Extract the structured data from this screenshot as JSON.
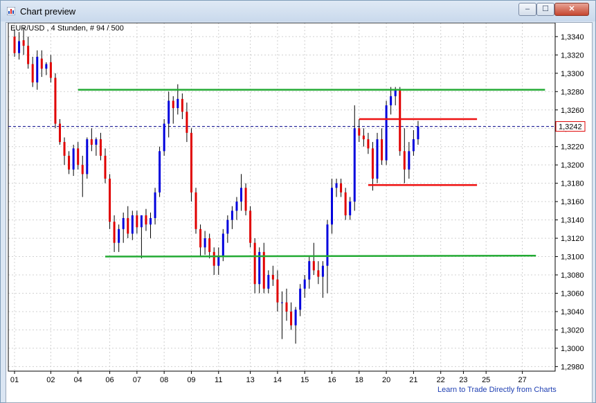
{
  "window": {
    "title": "Chart preview",
    "min_icon": "minimize-icon",
    "max_icon": "maximize-icon",
    "close_icon": "close-icon",
    "min_glyph": "–",
    "max_glyph": "☐",
    "close_glyph": "✕"
  },
  "chart_header": "EUR/USD , 4 Stunden, # 94 / 500",
  "footer_link": "Learn to Trade Directly from Charts",
  "current_price_label": "1,3242",
  "colors": {
    "up": "#0000dd",
    "down": "#e00000",
    "support": "#22aa33",
    "range": "#ee1111",
    "price_line": "#000088"
  },
  "chart_data": {
    "type": "candlestick",
    "title": "EUR/USD , 4 Stunden, # 94 / 500",
    "y_ticks": [
      "1,3340",
      "1,3320",
      "1,3300",
      "1,3280",
      "1,3260",
      "1,3240",
      "1,3220",
      "1,3200",
      "1,3180",
      "1,3160",
      "1,3140",
      "1,3120",
      "1,3100",
      "1,3080",
      "1,3060",
      "1,3040",
      "1,3020",
      "1,3000",
      "1,2980"
    ],
    "ylim": [
      1.2975,
      1.3355
    ],
    "x_ticks": [
      "01",
      "02",
      "04",
      "06",
      "07",
      "08",
      "09",
      "11",
      "13",
      "14",
      "15",
      "16",
      "18",
      "20",
      "21",
      "22",
      "23",
      "25",
      "27"
    ],
    "x_tick_index": [
      0,
      8,
      14,
      21,
      27,
      33,
      39,
      45,
      52,
      58,
      64,
      70,
      76,
      82,
      88,
      94,
      99,
      104,
      112
    ],
    "current_price": 1.3242,
    "lines": [
      {
        "name": "resistance",
        "color": "support",
        "i0": 14,
        "i1": 117,
        "y0": 1.3282,
        "y1": 1.3282
      },
      {
        "name": "support",
        "color": "support",
        "i0": 20,
        "i1": 115,
        "y0": 1.31,
        "y1": 1.3101
      },
      {
        "name": "range-top",
        "color": "range",
        "i0": 76,
        "i1": 102,
        "y0": 1.325,
        "y1": 1.325
      },
      {
        "name": "range-bottom",
        "color": "range",
        "i0": 78,
        "i1": 102,
        "y0": 1.3178,
        "y1": 1.3178
      }
    ],
    "ohlc": [
      [
        1.334,
        1.3348,
        1.3318,
        1.3322
      ],
      [
        1.3322,
        1.3345,
        1.3315,
        1.3335
      ],
      [
        1.3336,
        1.335,
        1.332,
        1.333
      ],
      [
        1.333,
        1.334,
        1.3305,
        1.331
      ],
      [
        1.331,
        1.3318,
        1.3285,
        1.329
      ],
      [
        1.329,
        1.3325,
        1.3282,
        1.3318
      ],
      [
        1.3316,
        1.3325,
        1.3296,
        1.3305
      ],
      [
        1.3305,
        1.3312,
        1.3298,
        1.331
      ],
      [
        1.3312,
        1.332,
        1.329,
        1.3295
      ],
      [
        1.3295,
        1.33,
        1.324,
        1.3245
      ],
      [
        1.3245,
        1.325,
        1.3222,
        1.3225
      ],
      [
        1.3225,
        1.323,
        1.32,
        1.321
      ],
      [
        1.321,
        1.3215,
        1.319,
        1.3195
      ],
      [
        1.3195,
        1.3222,
        1.3188,
        1.3218
      ],
      [
        1.3218,
        1.3225,
        1.3195,
        1.32
      ],
      [
        1.32,
        1.321,
        1.3165,
        1.319
      ],
      [
        1.319,
        1.323,
        1.3185,
        1.3228
      ],
      [
        1.3228,
        1.324,
        1.3215,
        1.3222
      ],
      [
        1.3222,
        1.323,
        1.321,
        1.3228
      ],
      [
        1.3228,
        1.3235,
        1.3205,
        1.321
      ],
      [
        1.321,
        1.3218,
        1.318,
        1.3185
      ],
      [
        1.3185,
        1.319,
        1.313,
        1.3138
      ],
      [
        1.3138,
        1.3145,
        1.3105,
        1.3115
      ],
      [
        1.3115,
        1.3135,
        1.3105,
        1.313
      ],
      [
        1.313,
        1.3148,
        1.3115,
        1.3142
      ],
      [
        1.3142,
        1.3155,
        1.312,
        1.3125
      ],
      [
        1.3125,
        1.315,
        1.3118,
        1.3145
      ],
      [
        1.3145,
        1.315,
        1.3125,
        1.3132
      ],
      [
        1.3132,
        1.314,
        1.3098,
        1.3145
      ],
      [
        1.3145,
        1.3152,
        1.3128,
        1.3135
      ],
      [
        1.3135,
        1.3148,
        1.312,
        1.3142
      ],
      [
        1.3142,
        1.3175,
        1.3135,
        1.317
      ],
      [
        1.317,
        1.322,
        1.3165,
        1.3215
      ],
      [
        1.3215,
        1.325,
        1.321,
        1.3245
      ],
      [
        1.3245,
        1.328,
        1.323,
        1.327
      ],
      [
        1.327,
        1.3275,
        1.3245,
        1.3262
      ],
      [
        1.3262,
        1.3288,
        1.3255,
        1.3272
      ],
      [
        1.3272,
        1.3278,
        1.325,
        1.3258
      ],
      [
        1.3258,
        1.3268,
        1.3225,
        1.3235
      ],
      [
        1.3235,
        1.324,
        1.316,
        1.317
      ],
      [
        1.317,
        1.3175,
        1.3125,
        1.313
      ],
      [
        1.313,
        1.3135,
        1.31,
        1.311
      ],
      [
        1.311,
        1.3128,
        1.3102,
        1.312
      ],
      [
        1.312,
        1.3125,
        1.3098,
        1.3105
      ],
      [
        1.3105,
        1.311,
        1.308,
        1.309
      ],
      [
        1.309,
        1.311,
        1.308,
        1.31
      ],
      [
        1.31,
        1.313,
        1.3095,
        1.3125
      ],
      [
        1.3125,
        1.3145,
        1.3115,
        1.314
      ],
      [
        1.314,
        1.3155,
        1.313,
        1.315
      ],
      [
        1.315,
        1.3165,
        1.314,
        1.316
      ],
      [
        1.316,
        1.319,
        1.315,
        1.3175
      ],
      [
        1.3175,
        1.318,
        1.3145,
        1.315
      ],
      [
        1.315,
        1.3155,
        1.311,
        1.3115
      ],
      [
        1.3115,
        1.312,
        1.306,
        1.307
      ],
      [
        1.307,
        1.311,
        1.306,
        1.3105
      ],
      [
        1.3105,
        1.3115,
        1.306,
        1.3065
      ],
      [
        1.3065,
        1.3085,
        1.306,
        1.308
      ],
      [
        1.308,
        1.309,
        1.3068,
        1.3075
      ],
      [
        1.3075,
        1.3085,
        1.304,
        1.305
      ],
      [
        1.305,
        1.3062,
        1.301,
        1.305
      ],
      [
        1.305,
        1.3065,
        1.303,
        1.304
      ],
      [
        1.304,
        1.305,
        1.302,
        1.3025
      ],
      [
        1.3025,
        1.3045,
        1.3005,
        1.3042
      ],
      [
        1.3042,
        1.307,
        1.3035,
        1.3065
      ],
      [
        1.3065,
        1.308,
        1.3055,
        1.3075
      ],
      [
        1.3075,
        1.31,
        1.3065,
        1.3095
      ],
      [
        1.3095,
        1.3115,
        1.308,
        1.3085
      ],
      [
        1.3085,
        1.3095,
        1.307,
        1.3078
      ],
      [
        1.3078,
        1.3095,
        1.3055,
        1.309
      ],
      [
        1.309,
        1.314,
        1.306,
        1.3135
      ],
      [
        1.3135,
        1.3185,
        1.3125,
        1.3175
      ],
      [
        1.3175,
        1.3185,
        1.3165,
        1.318
      ],
      [
        1.318,
        1.3185,
        1.3165,
        1.317
      ],
      [
        1.317,
        1.3175,
        1.314,
        1.3145
      ],
      [
        1.3145,
        1.3165,
        1.314,
        1.316
      ],
      [
        1.316,
        1.3265,
        1.315,
        1.324
      ],
      [
        1.324,
        1.325,
        1.3225,
        1.3232
      ],
      [
        1.3232,
        1.324,
        1.322,
        1.3228
      ],
      [
        1.3228,
        1.3235,
        1.3212,
        1.3218
      ],
      [
        1.3218,
        1.3225,
        1.3172,
        1.3185
      ],
      [
        1.3185,
        1.3235,
        1.318,
        1.3228
      ],
      [
        1.3228,
        1.324,
        1.32,
        1.3205
      ],
      [
        1.3205,
        1.327,
        1.32,
        1.3265
      ],
      [
        1.3265,
        1.3285,
        1.3255,
        1.3275
      ],
      [
        1.3275,
        1.3285,
        1.3265,
        1.3282
      ],
      [
        1.3282,
        1.3285,
        1.321,
        1.3215
      ],
      [
        1.3215,
        1.324,
        1.318,
        1.3195
      ],
      [
        1.3195,
        1.3225,
        1.3185,
        1.3215
      ],
      [
        1.3215,
        1.3238,
        1.321,
        1.3228
      ],
      [
        1.3228,
        1.3248,
        1.3222,
        1.3242
      ]
    ]
  }
}
